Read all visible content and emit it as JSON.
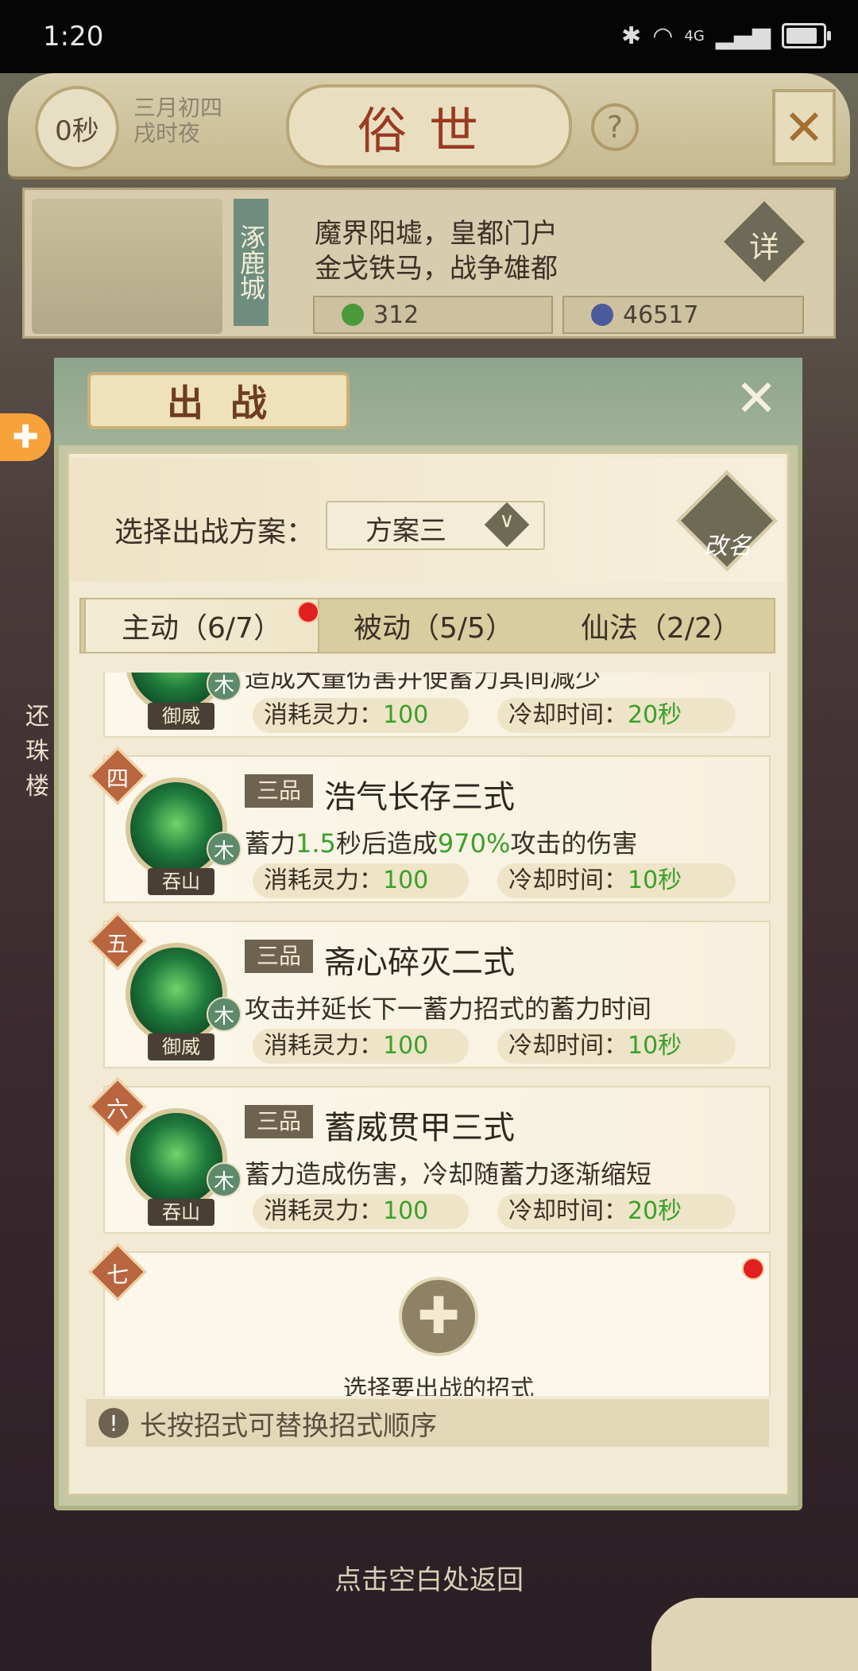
{
  "status_bar": {
    "time": "1:20",
    "bluetooth_icon": "bluetooth-icon",
    "wifi_icon": "wifi-icon",
    "signal_label": "4G",
    "battery_level": 0.75
  },
  "header": {
    "timer": "0秒",
    "date_line1": "三月初四",
    "date_line2": "戌时夜",
    "title": "俗世",
    "help_label": "?",
    "close_icon": "close-icon"
  },
  "city": {
    "name": "涿鹿城",
    "desc_line1": "魔界阳墟，皇都门户",
    "desc_line2": "金戈铁马，战争雄都",
    "detail_label": "详",
    "resource1": "312",
    "resource2": "46517"
  },
  "side": {
    "text": "还珠楼"
  },
  "dialog": {
    "title": "出战",
    "plan_label": "选择出战方案：",
    "plan_value": "方案三",
    "rename_label": "改名",
    "tabs": [
      {
        "label": "主动（6/7）"
      },
      {
        "label": "被动（5/5）"
      },
      {
        "label": "仙法（2/2）"
      }
    ],
    "skills": [
      {
        "num": "",
        "grade": "",
        "name": "",
        "element": "木",
        "sect": "御威",
        "desc": "造成大量伤害并使蓄力其间减少",
        "cost_label": "消耗灵力：",
        "cost": "100",
        "cd_label": "冷却时间：",
        "cd": "20秒"
      },
      {
        "num": "四",
        "grade": "三品",
        "name": "浩气长存三式",
        "element": "木",
        "sect": "吞山",
        "desc_a": "蓄力",
        "desc_b": "1.5",
        "desc_c": "秒后造成",
        "desc_d": "970%",
        "desc_e": "攻击的伤害",
        "cost_label": "消耗灵力：",
        "cost": "100",
        "cd_label": "冷却时间：",
        "cd": "10秒"
      },
      {
        "num": "五",
        "grade": "三品",
        "name": "斋心碎灭二式",
        "element": "木",
        "sect": "御威",
        "desc": "攻击并延长下一蓄力招式的蓄力时间",
        "cost_label": "消耗灵力：",
        "cost": "100",
        "cd_label": "冷却时间：",
        "cd": "10秒"
      },
      {
        "num": "六",
        "grade": "三品",
        "name": "蓄威贯甲三式",
        "element": "木",
        "sect": "吞山",
        "desc": "蓄力造成伤害，冷却随蓄力逐渐缩短",
        "cost_label": "消耗灵力：",
        "cost": "100",
        "cd_label": "冷却时间：",
        "cd": "20秒"
      }
    ],
    "empty_slot": {
      "num": "七",
      "label": "选择要出战的招式"
    },
    "hint": "长按招式可替换招式顺序"
  },
  "footer": {
    "back": "点击空白处返回"
  },
  "colors": {
    "accent_red": "#e02020",
    "value_green": "#3aa02a"
  }
}
